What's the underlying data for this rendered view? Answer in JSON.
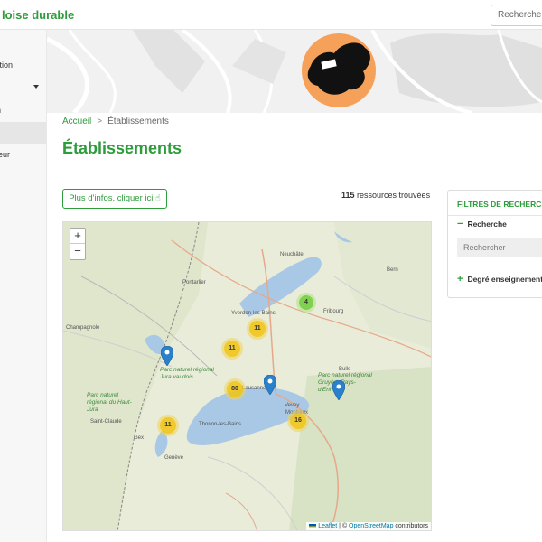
{
  "header": {
    "brand": "loise durable",
    "search_label": "Recherche"
  },
  "sidebar": {
    "items": [
      {
        "label": "ducation"
      },
      {
        "label": "n"
      },
      {
        "label": ""
      },
      {
        "label": "érieur"
      }
    ]
  },
  "breadcrumb": {
    "home": "Accueil",
    "separator": ">",
    "current": "Établissements"
  },
  "page": {
    "title": "Établissements",
    "info_button": "Plus d'infos, cliquer ici",
    "result_count": "115",
    "result_suffix": " ressources trouvées"
  },
  "map": {
    "zoom_in": "+",
    "zoom_out": "−",
    "clusters": [
      {
        "count": "4",
        "color": "green"
      },
      {
        "count": "11",
        "color": "yellow"
      },
      {
        "count": "11",
        "color": "yellow"
      },
      {
        "count": "80",
        "color": "yellow"
      },
      {
        "count": "11",
        "color": "yellow"
      },
      {
        "count": "16",
        "color": "yellow"
      }
    ],
    "markers_count": 3,
    "place_labels": [
      "Pontarlier",
      "Champagnole",
      "Neuchâtel",
      "Fribourg",
      "Bern",
      "Yverdon-les-Bains",
      "Lausanne",
      "Vevey",
      "Thonon-les-Bains",
      "Saint-Claude",
      "Gex",
      "Genève",
      "Montreux",
      "Bulle"
    ],
    "park_labels": [
      "Parc naturel régional Jura vaudois",
      "Parc naturel régional du Haut-Jura",
      "Parc naturel régional Gruyère Pays-d'Enhaut"
    ],
    "attribution": {
      "leaflet": "Leaflet",
      "divider": " | © ",
      "osm": "OpenStreetMap",
      "suffix": " contributors"
    }
  },
  "filters": {
    "title": "FILTRES DE RECHERCHE",
    "search_section": "Recherche",
    "search_placeholder": "Rechercher",
    "degree_section": "Degré enseignement"
  },
  "colors": {
    "accent": "#2d9c3a",
    "cluster_yellow": "#f0c20c",
    "cluster_green": "#6ecc39",
    "marker": "#2a81cb",
    "logo_orange": "#f6a15a"
  }
}
